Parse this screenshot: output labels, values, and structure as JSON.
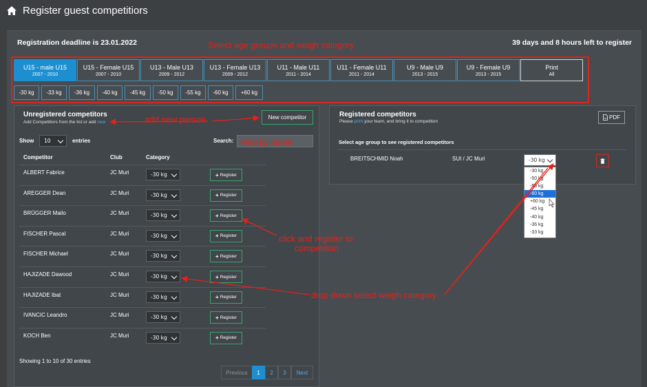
{
  "header": {
    "title": "Register guest competitiors",
    "home_icon": "home-icon"
  },
  "deadline": "Registration deadline is 23.01.2022",
  "time_left": "39 days and 8 hours left to register",
  "annotations": {
    "select_age": "Select age groups and weigh category",
    "add_new": "add new person",
    "find_by_name": "Find by name",
    "click_register_1": "click and register to",
    "click_register_2": "competition",
    "dropdown_select": "drop down select weigh category"
  },
  "age_groups": [
    {
      "name": "U15 - male U15",
      "years": "2007 - 2010",
      "active": true
    },
    {
      "name": "U15 - Female U15",
      "years": "2007 - 2010"
    },
    {
      "name": "U13 - Male U13",
      "years": "2009 - 2012"
    },
    {
      "name": "U13 - Female U13",
      "years": "2009 - 2012"
    },
    {
      "name": "U11 - Male U11",
      "years": "2011 - 2014"
    },
    {
      "name": "U11 - Female U11",
      "years": "2011 - 2014"
    },
    {
      "name": "U9 - Male U9",
      "years": "2013 - 2015"
    },
    {
      "name": "U9 - Female U9",
      "years": "2013 - 2015"
    },
    {
      "name": "Print",
      "years": "All"
    }
  ],
  "weights": [
    "-30 kg",
    "-33 kg",
    "-36 kg",
    "-40 kg",
    "-45 kg",
    "-50 kg",
    "-55 kg",
    "-60 kg",
    "+60 kg"
  ],
  "unregistered": {
    "title": "Unregistered competitors",
    "subtitle_prefix": "Add Competitiors from the list or add ",
    "subtitle_link": "new",
    "new_button": "New competitor",
    "show_label": "Show",
    "show_value": "10",
    "entries_label": "entries",
    "search_label": "Search:",
    "columns": [
      "Competitor",
      "Club",
      "Category"
    ],
    "register_label": "Register",
    "rows": [
      {
        "name": "ALBERT Fabrice",
        "club": "JC Muri",
        "category": "-30 kg"
      },
      {
        "name": "AREGGER Dean",
        "club": "JC Muri",
        "category": "-30 kg"
      },
      {
        "name": "BRÜGGER Mailo",
        "club": "JC Muri",
        "category": "-30 kg"
      },
      {
        "name": "FISCHER Pascal",
        "club": "JC Muri",
        "category": "-30 kg"
      },
      {
        "name": "FISCHER Michael",
        "club": "JC Muri",
        "category": "-30 kg"
      },
      {
        "name": "HAJIZADE Dawood",
        "club": "JC Muri",
        "category": "-30 kg"
      },
      {
        "name": "HAJIZADE Ibat",
        "club": "JC Muri",
        "category": "-30 kg"
      },
      {
        "name": "IVANCIC Leandro",
        "club": "JC Muri",
        "category": "-30 kg"
      },
      {
        "name": "KOCH Ben",
        "club": "JC Muri",
        "category": "-30 kg"
      }
    ],
    "showing": "Showing 1 to 10 of 30 entries",
    "pagination": {
      "previous": "Previous",
      "pages": [
        "1",
        "2",
        "3"
      ],
      "next": "Next",
      "current": "1"
    }
  },
  "registered": {
    "title": "Registered competitors",
    "subtitle_prefix": "Please ",
    "subtitle_link": "print",
    "subtitle_suffix": " your team, and bring it to competition",
    "pdf_label": "PDF",
    "instruction": "Select age group to see registered competitors",
    "rows": [
      {
        "name": "BREITSCHMID Noah",
        "club": "SUI / JC Muri",
        "category": "-30 kg"
      }
    ],
    "dropdown_options": [
      "-30 kg",
      "-50 kg",
      "-55 kg",
      "-60 kg",
      "+60 kg",
      "-45 kg",
      "-40 kg",
      "-36 kg",
      "-33 kg"
    ],
    "dropdown_selected": "-60 kg"
  },
  "colors": {
    "accent": "#1d8fd1",
    "annotation": "#e8201a",
    "register_border": "#3aa56d"
  }
}
